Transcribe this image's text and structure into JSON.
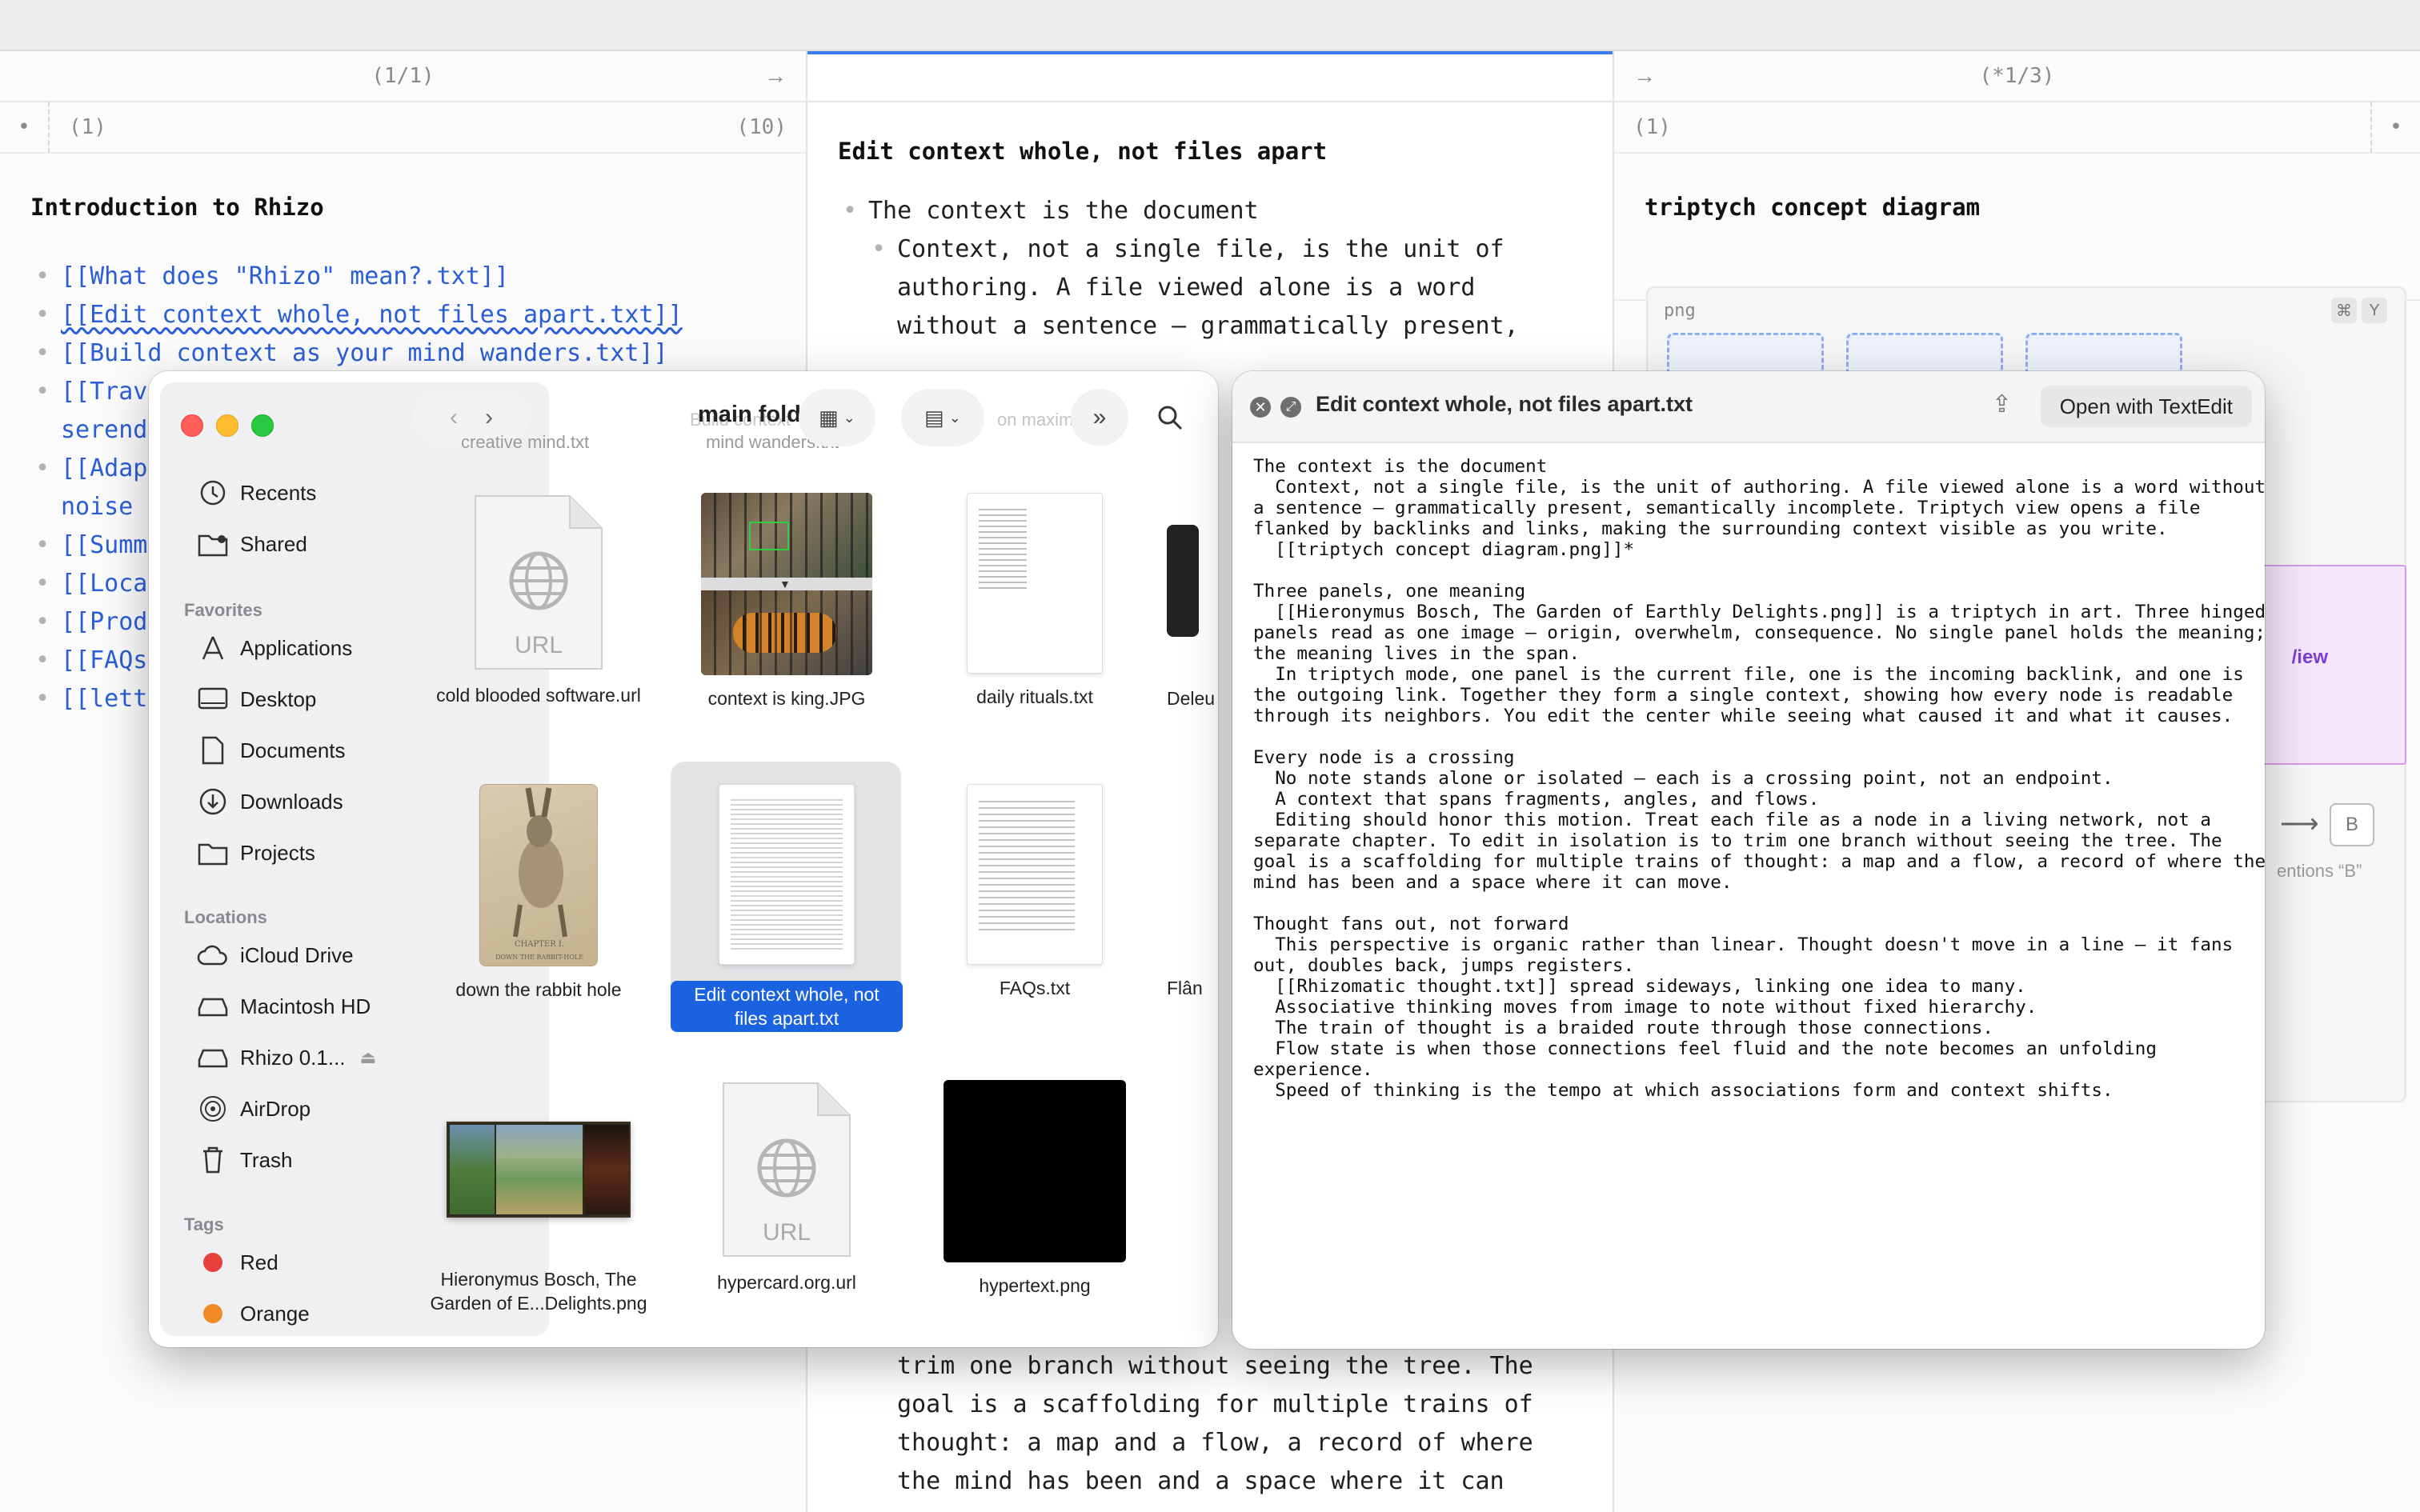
{
  "left_pane": {
    "header_counter": "(1/1)",
    "sub_left": "(1)",
    "sub_right": "(10)",
    "title": "Introduction to Rhizo",
    "links": [
      "[[What does \"Rhizo\" mean?.txt]]",
      "[[Edit context whole, not files apart.txt]]",
      "[[Build context as your mind wanders.txt]]",
      "[[Trave",
      "serend",
      "[[Adap",
      "noise",
      "[[Summ",
      "[[Loca",
      "[[Prod",
      "[[FAQs",
      "[[lett"
    ]
  },
  "center_pane": {
    "title": "Edit context whole, not files apart",
    "top_lines": [
      "The context is the document",
      "Context, not a single file, is the unit of",
      "authoring. A file viewed alone is a word",
      "without a sentence — grammatically present,"
    ],
    "bottom_lines": [
      "trim one branch without seeing the tree. The",
      "goal is a scaffolding for multiple trains of",
      "thought: a map and a flow, a record of where",
      "the mind has been and a space where it can"
    ]
  },
  "right_pane": {
    "header_counter": "(*1/3)",
    "sub_left": "(1)",
    "title": "triptych concept diagram",
    "image_format": "png",
    "shortcut_keys": [
      "⌘",
      "Y"
    ],
    "peek_text": "/iew",
    "node_b": "B",
    "mentions_text": "entions “B”"
  },
  "finder": {
    "folder_name": "main folder",
    "ghost_labels": [
      "creative mind.txt",
      "mind wanders.txt",
      "Build context",
      "on maxima"
    ],
    "sidebar": {
      "top_items": [
        "Recents",
        "Shared"
      ],
      "favorites_label": "Favorites",
      "favorites": [
        "Applications",
        "Desktop",
        "Documents",
        "Downloads",
        "Projects"
      ],
      "locations_label": "Locations",
      "locations": [
        "iCloud Drive",
        "Macintosh HD",
        "Rhizo 0.1...",
        "AirDrop",
        "Trash"
      ],
      "tags_label": "Tags",
      "tags": [
        "Red",
        "Orange"
      ],
      "tag_colors": [
        "#e8403a",
        "#f08a25"
      ]
    },
    "files": [
      {
        "name": "cold blooded software.url",
        "kind": "url"
      },
      {
        "name": "context is king.JPG",
        "kind": "photo"
      },
      {
        "name": "daily rituals.txt",
        "kind": "txt"
      },
      {
        "name": "Deleu",
        "kind": "partial"
      },
      {
        "name": "down the rabbit hole",
        "kind": "rabbit"
      },
      {
        "name": "Edit context whole, not files apart.txt",
        "kind": "txt-selected"
      },
      {
        "name": "FAQs.txt",
        "kind": "txt"
      },
      {
        "name": "Flân",
        "kind": "partial"
      },
      {
        "name": "Hieronymus Bosch, The Garden of E...Delights.png",
        "kind": "painting"
      },
      {
        "name": "hypercard.org.url",
        "kind": "url"
      },
      {
        "name": "hypertext.png",
        "kind": "black"
      }
    ],
    "url_badge": "URL"
  },
  "quicklook": {
    "title": "Edit context whole, not files apart.txt",
    "open_button": "Open with TextEdit",
    "body": "The context is the document\n  Context, not a single file, is the unit of authoring. A file viewed alone is a word without\na sentence — grammatically present, semantically incomplete. Triptych view opens a file\nflanked by backlinks and links, making the surrounding context visible as you write.\n  [[triptych concept diagram.png]]*\n\nThree panels, one meaning\n  [[Hieronymus Bosch, The Garden of Earthly Delights.png]] is a triptych in art. Three hinged\npanels read as one image — origin, overwhelm, consequence. No single panel holds the meaning;\nthe meaning lives in the span.\n  In triptych mode, one panel is the current file, one is the incoming backlink, and one is\nthe outgoing link. Together they form a single context, showing how every node is readable\nthrough its neighbors. You edit the center while seeing what caused it and what it causes.\n\nEvery node is a crossing\n  No note stands alone or isolated — each is a crossing point, not an endpoint.\n  A context that spans fragments, angles, and flows.\n  Editing should honor this motion. Treat each file as a node in a living network, not a\nseparate chapter. To edit in isolation is to trim one branch without seeing the tree. The\ngoal is a scaffolding for multiple trains of thought: a map and a flow, a record of where the\nmind has been and a space where it can move.\n\nThought fans out, not forward\n  This perspective is organic rather than linear. Thought doesn't move in a line — it fans\nout, doubles back, jumps registers.\n  [[Rhizomatic thought.txt]] spread sideways, linking one idea to many.\n  Associative thinking moves from image to note without fixed hierarchy.\n  The train of thought is a braided route through those connections.\n  Flow state is when those connections feel fluid and the note becomes an unfolding\nexperience.\n  Speed of thinking is the tempo at which associations form and context shifts."
  }
}
